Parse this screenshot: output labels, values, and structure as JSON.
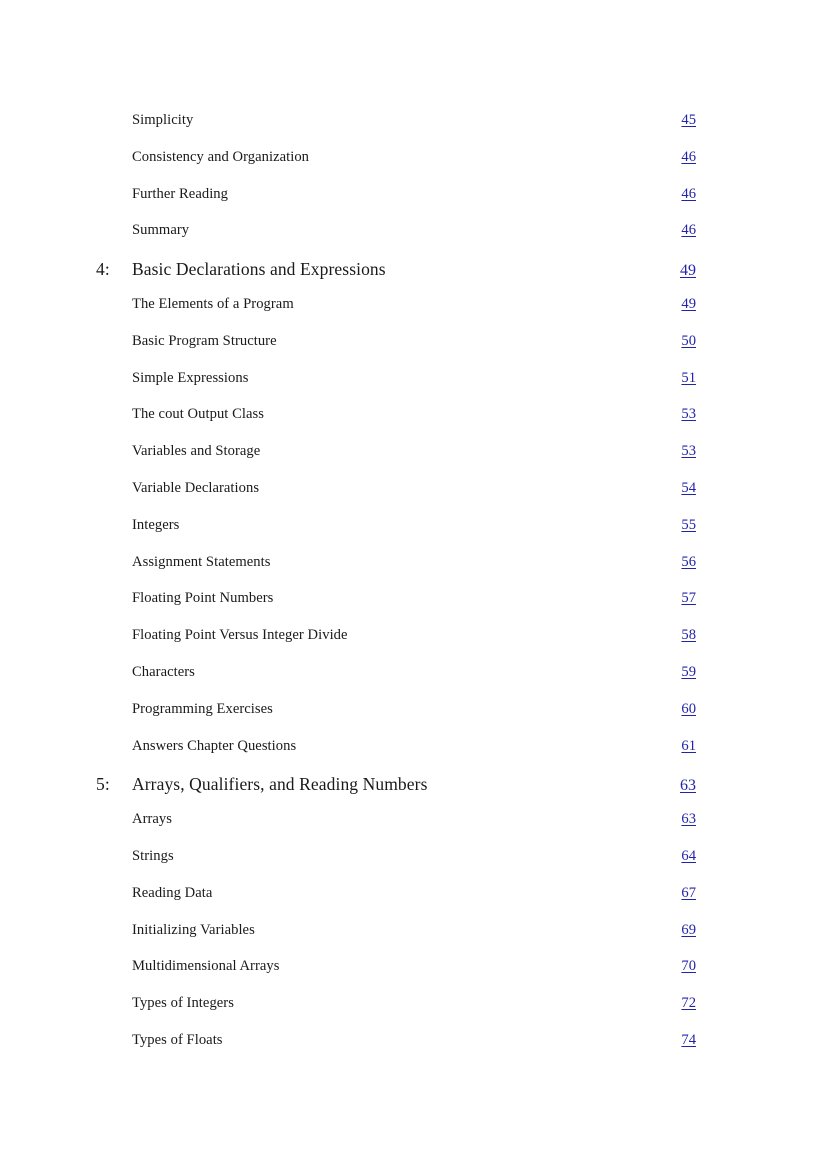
{
  "document": {
    "type": "table-of-contents",
    "link_color": "#2222aa",
    "text_color": "#1a1a1a",
    "background_color": "#ffffff"
  },
  "entries": [
    {
      "level": "section",
      "number": "",
      "title": "Simplicity",
      "page": "45"
    },
    {
      "level": "section",
      "number": "",
      "title": "Consistency and Organization",
      "page": "46"
    },
    {
      "level": "section",
      "number": "",
      "title": "Further Reading",
      "page": "46"
    },
    {
      "level": "section",
      "number": "",
      "title": "Summary",
      "page": "46"
    },
    {
      "level": "chapter",
      "number": "4:",
      "title": "Basic Declarations and Expressions",
      "page": "49"
    },
    {
      "level": "section",
      "number": "",
      "title": "The Elements of a Program",
      "page": "49"
    },
    {
      "level": "section",
      "number": "",
      "title": "Basic Program Structure",
      "page": "50"
    },
    {
      "level": "section",
      "number": "",
      "title": "Simple Expressions",
      "page": "51"
    },
    {
      "level": "section",
      "number": "",
      "title": "The cout Output Class",
      "page": "53"
    },
    {
      "level": "section",
      "number": "",
      "title": "Variables and Storage",
      "page": "53"
    },
    {
      "level": "section",
      "number": "",
      "title": "Variable Declarations",
      "page": "54"
    },
    {
      "level": "section",
      "number": "",
      "title": "Integers",
      "page": "55"
    },
    {
      "level": "section",
      "number": "",
      "title": "Assignment Statements",
      "page": "56"
    },
    {
      "level": "section",
      "number": "",
      "title": "Floating Point Numbers",
      "page": "57"
    },
    {
      "level": "section",
      "number": "",
      "title": "Floating Point Versus Integer Divide",
      "page": "58"
    },
    {
      "level": "section",
      "number": "",
      "title": "Characters",
      "page": "59"
    },
    {
      "level": "section",
      "number": "",
      "title": "Programming Exercises",
      "page": "60"
    },
    {
      "level": "section",
      "number": "",
      "title": "Answers Chapter Questions",
      "page": "61"
    },
    {
      "level": "chapter",
      "number": "5:",
      "title": "Arrays, Qualifiers, and Reading Numbers",
      "page": "63"
    },
    {
      "level": "section",
      "number": "",
      "title": "Arrays",
      "page": "63"
    },
    {
      "level": "section",
      "number": "",
      "title": "Strings",
      "page": "64"
    },
    {
      "level": "section",
      "number": "",
      "title": "Reading Data",
      "page": "67"
    },
    {
      "level": "section",
      "number": "",
      "title": "Initializing Variables",
      "page": "69"
    },
    {
      "level": "section",
      "number": "",
      "title": "Multidimensional Arrays",
      "page": "70"
    },
    {
      "level": "section",
      "number": "",
      "title": "Types of Integers",
      "page": "72"
    },
    {
      "level": "section",
      "number": "",
      "title": "Types of Floats",
      "page": "74"
    }
  ]
}
